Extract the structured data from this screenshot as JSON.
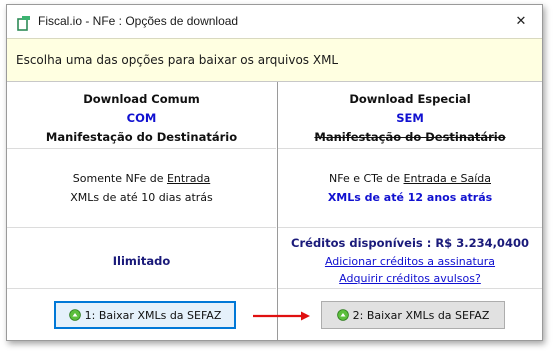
{
  "window": {
    "title": "Fiscal.io - NFe : Opções de download",
    "close_glyph": "✕"
  },
  "banner": {
    "text": "Escolha uma das opções para baixar os arquivos XML"
  },
  "left": {
    "heading": "Download Comum",
    "com": "COM",
    "manifest": "Manifestação do Destinatário",
    "desc_prefix": "Somente NFe de ",
    "desc_link": "Entrada",
    "xml_age": "XMLs de até 10 dias atrás",
    "limit": "Ilimitado",
    "button_label": "1: Baixar XMLs da SEFAZ"
  },
  "right": {
    "heading": "Download Especial",
    "sem": "SEM",
    "manifest": "Manifestação do Destinatário",
    "desc_prefix": "NFe e CTe de ",
    "desc_link": "Entrada e Saída",
    "xml_age": "XMLs de até 12 anos atrás",
    "credits": "Créditos disponíveis : R$  3.234,0400",
    "link1": "Adicionar créditos a assinatura",
    "link2": "Adquirir créditos avulsos?",
    "button_label": "2: Baixar XMLs da SEFAZ"
  },
  "colors": {
    "accent": "#0078d7",
    "link": "#1010d0",
    "arrow": "#e01010",
    "banner": "#ffffe1"
  },
  "icons": [
    "app-icon",
    "close-icon",
    "download-icon",
    "arrow-icon"
  ]
}
